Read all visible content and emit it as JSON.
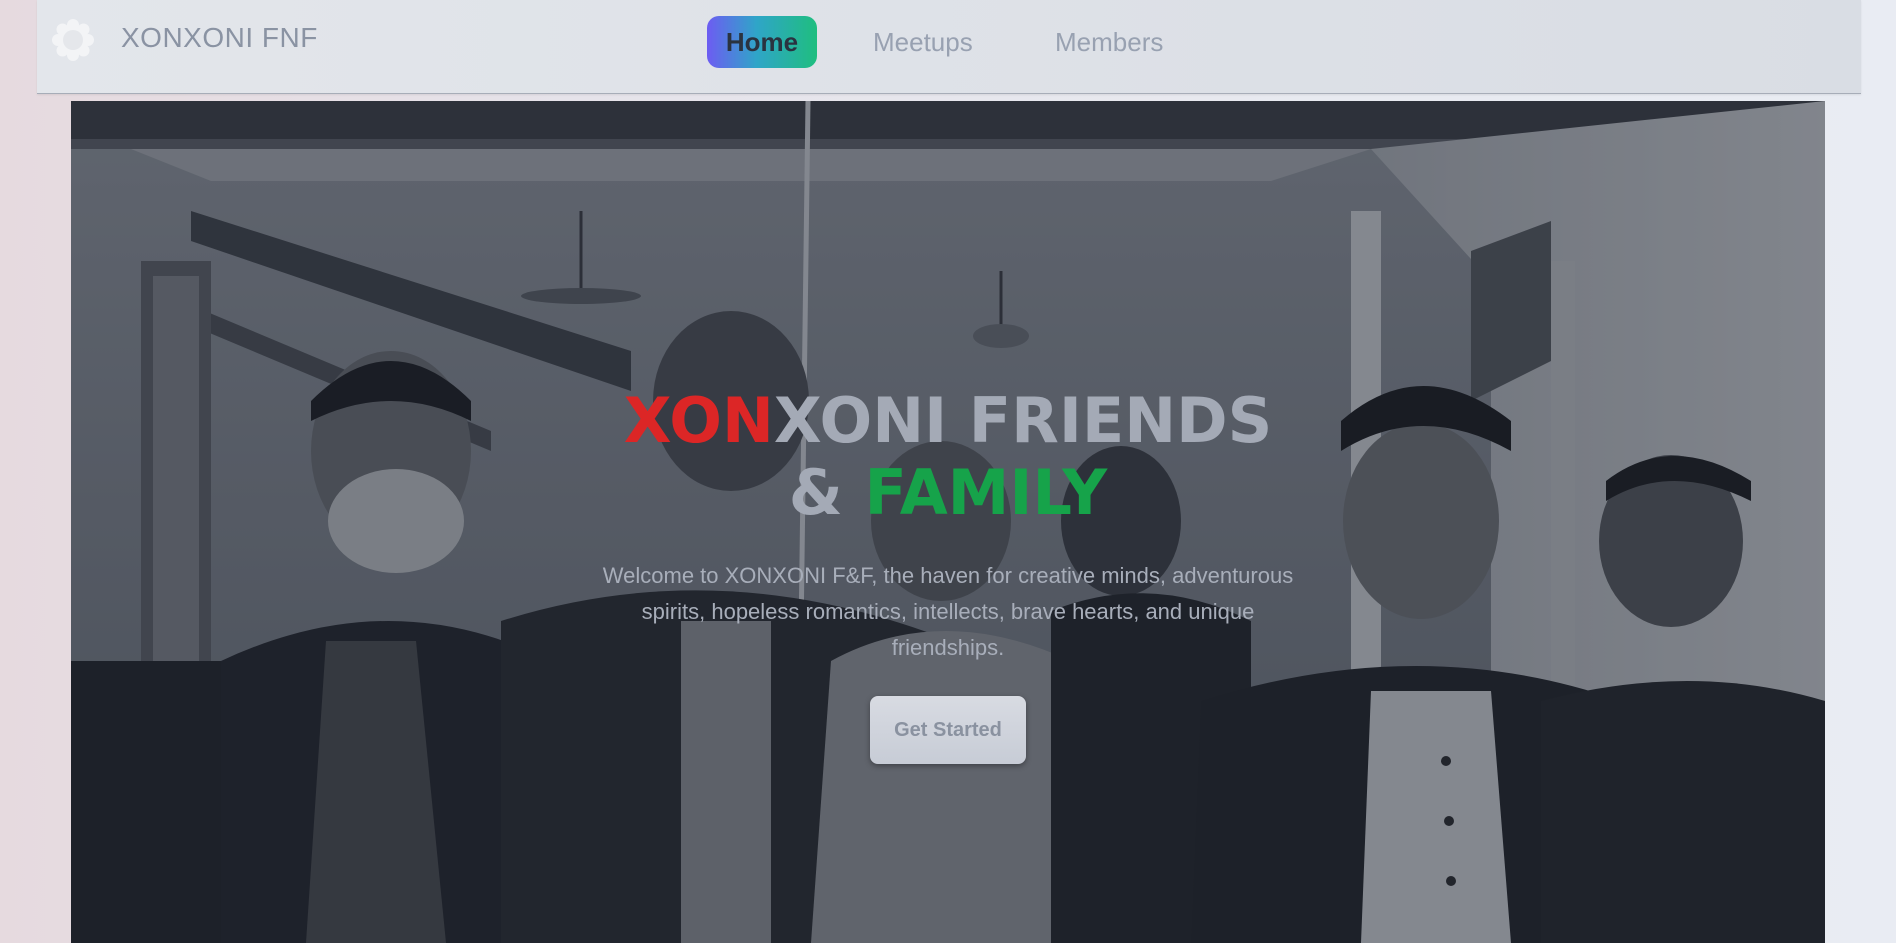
{
  "nav": {
    "brand": "XONXONI FNF",
    "logo_icon": "flower-logo-icon",
    "items": [
      {
        "label": "Home",
        "active": true
      },
      {
        "label": "Meetups",
        "active": false
      },
      {
        "label": "Members",
        "active": false
      }
    ]
  },
  "hero": {
    "title_red": "XON",
    "title_rest": "XONI FRIENDS",
    "title_amp": "& ",
    "title_green": "FAMILY",
    "description": "Welcome to XONXONI F&F, the haven for creative minds, adventurous spirits, hopeless romantics, intellects, brave hearts, and unique friendships.",
    "cta_label": "Get Started",
    "photo_icon": "group-photo-image"
  },
  "colors": {
    "accent_red": "#dc2626",
    "accent_green": "#16a34a",
    "active_tab_gradient_start": "#6d5cf2",
    "active_tab_gradient_end": "#1fbe7f"
  }
}
